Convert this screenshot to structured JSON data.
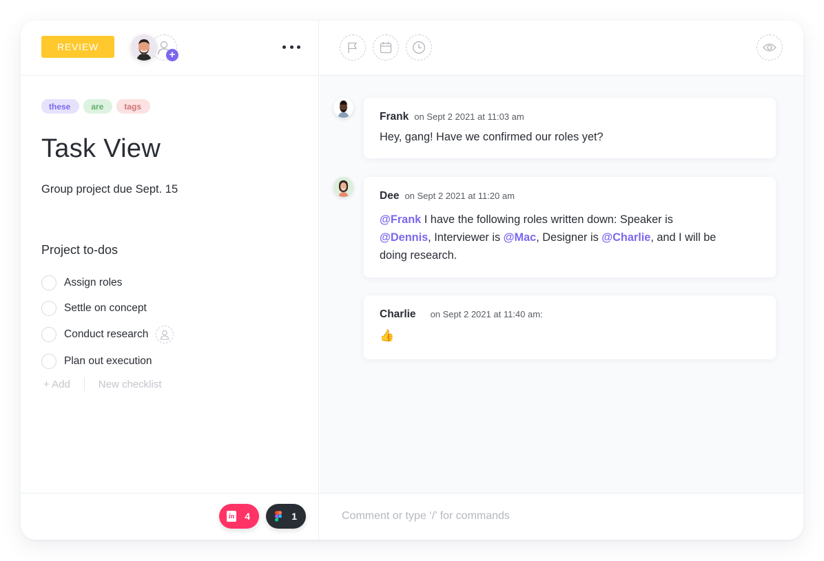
{
  "task": {
    "status": "REVIEW",
    "status_color": "#ffc82c",
    "tags": [
      {
        "label": "these",
        "color": "#7b68ee"
      },
      {
        "label": "are",
        "color": "#5fae6c"
      },
      {
        "label": "tags",
        "color": "#d07575"
      }
    ],
    "title": "Task View",
    "description": "Group project due Sept. 15"
  },
  "header": {
    "assignee_avatar": "avatar-man",
    "add_assignee_icon": "user-plus-icon",
    "more_icon": "ellipsis-icon",
    "toolbar_icons": [
      "flag-icon",
      "calendar-icon",
      "clock-icon"
    ],
    "watch_icon": "eye-icon"
  },
  "checklist": {
    "title": "Project to-dos",
    "items": [
      {
        "label": "Assign roles",
        "done": false
      },
      {
        "label": "Settle on concept",
        "done": false
      },
      {
        "label": "Conduct research",
        "done": false,
        "assign_icon": true
      },
      {
        "label": "Plan out execution",
        "done": false
      }
    ],
    "add_label": "+ Add",
    "new_checklist_label": "New checklist"
  },
  "attachments": [
    {
      "app": "InVision",
      "icon": "invision-icon",
      "count": "4",
      "color": "#ff3366"
    },
    {
      "app": "Figma",
      "icon": "figma-icon",
      "count": "1",
      "color": "#292d34"
    }
  ],
  "comments": [
    {
      "author": "Frank",
      "date": "on Sept 2 2021 at 11:03 am",
      "body": "Hey, gang! Have we confirmed our roles yet?"
    },
    {
      "author": "Dee",
      "date": "on Sept 2 2021 at 11:20 am",
      "parts": [
        {
          "text": "@Frank",
          "mention": true
        },
        {
          "text": " I have the following roles written down: Speaker is ",
          "mention": false
        },
        {
          "text": "@Dennis",
          "mention": true
        },
        {
          "text": ", Interviewer is ",
          "mention": false
        },
        {
          "text": "@Mac",
          "mention": true
        },
        {
          "text": ", Designer is ",
          "mention": false
        },
        {
          "text": "@Charlie",
          "mention": true
        },
        {
          "text": ", and I will be doing research.",
          "mention": false
        }
      ]
    },
    {
      "author": "Charlie",
      "date": "on Sept 2 2021 at 11:40 am:",
      "body": "👍"
    }
  ],
  "comment_input": {
    "placeholder": "Comment or type ‘/’ for commands",
    "value": ""
  },
  "colors": {
    "accent": "#7b68ee",
    "text": "#292d34",
    "panel_bg": "#f9fafc"
  }
}
